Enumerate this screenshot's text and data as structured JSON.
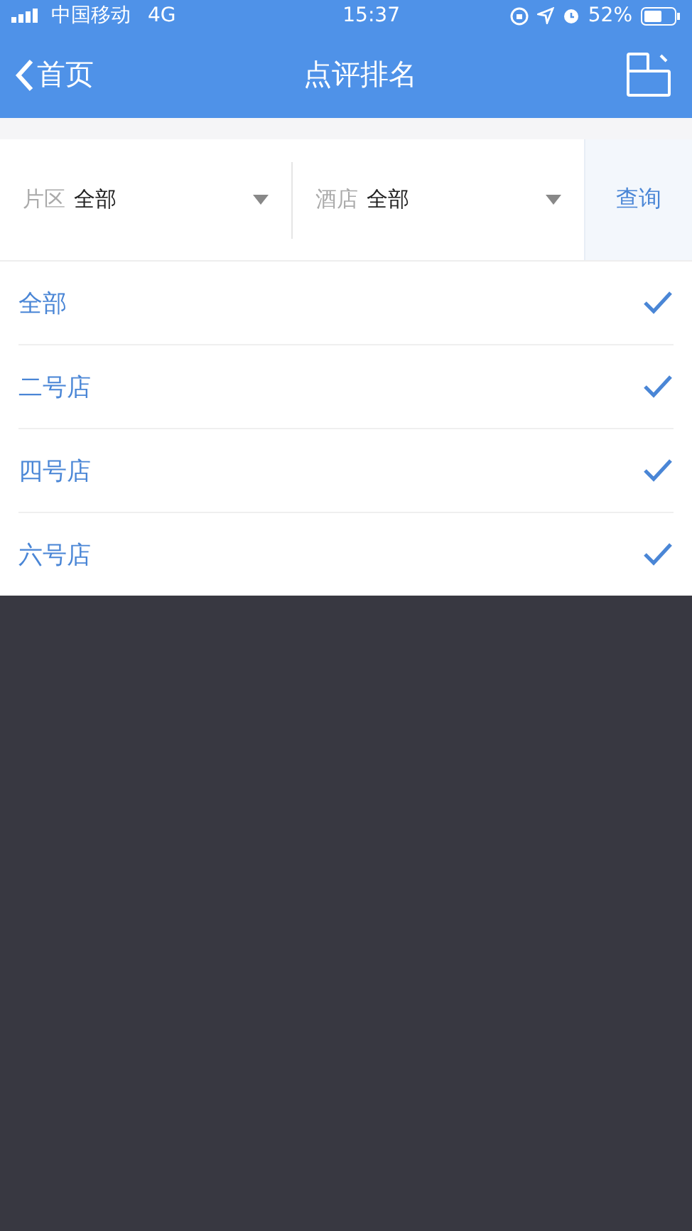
{
  "status_bar": {
    "carrier": "中国移动",
    "network": "4G",
    "time": "15:37",
    "battery": "52%"
  },
  "nav": {
    "back": "首页",
    "title": "点评排名"
  },
  "filters": [
    {
      "label": "片区",
      "value": "全部"
    },
    {
      "label": "酒店",
      "value": "全部"
    }
  ],
  "query_button": "查询",
  "options": [
    {
      "label": "全部",
      "selected": true
    },
    {
      "label": "二号店",
      "selected": true
    },
    {
      "label": "四号店",
      "selected": true
    },
    {
      "label": "六号店",
      "selected": true
    }
  ]
}
